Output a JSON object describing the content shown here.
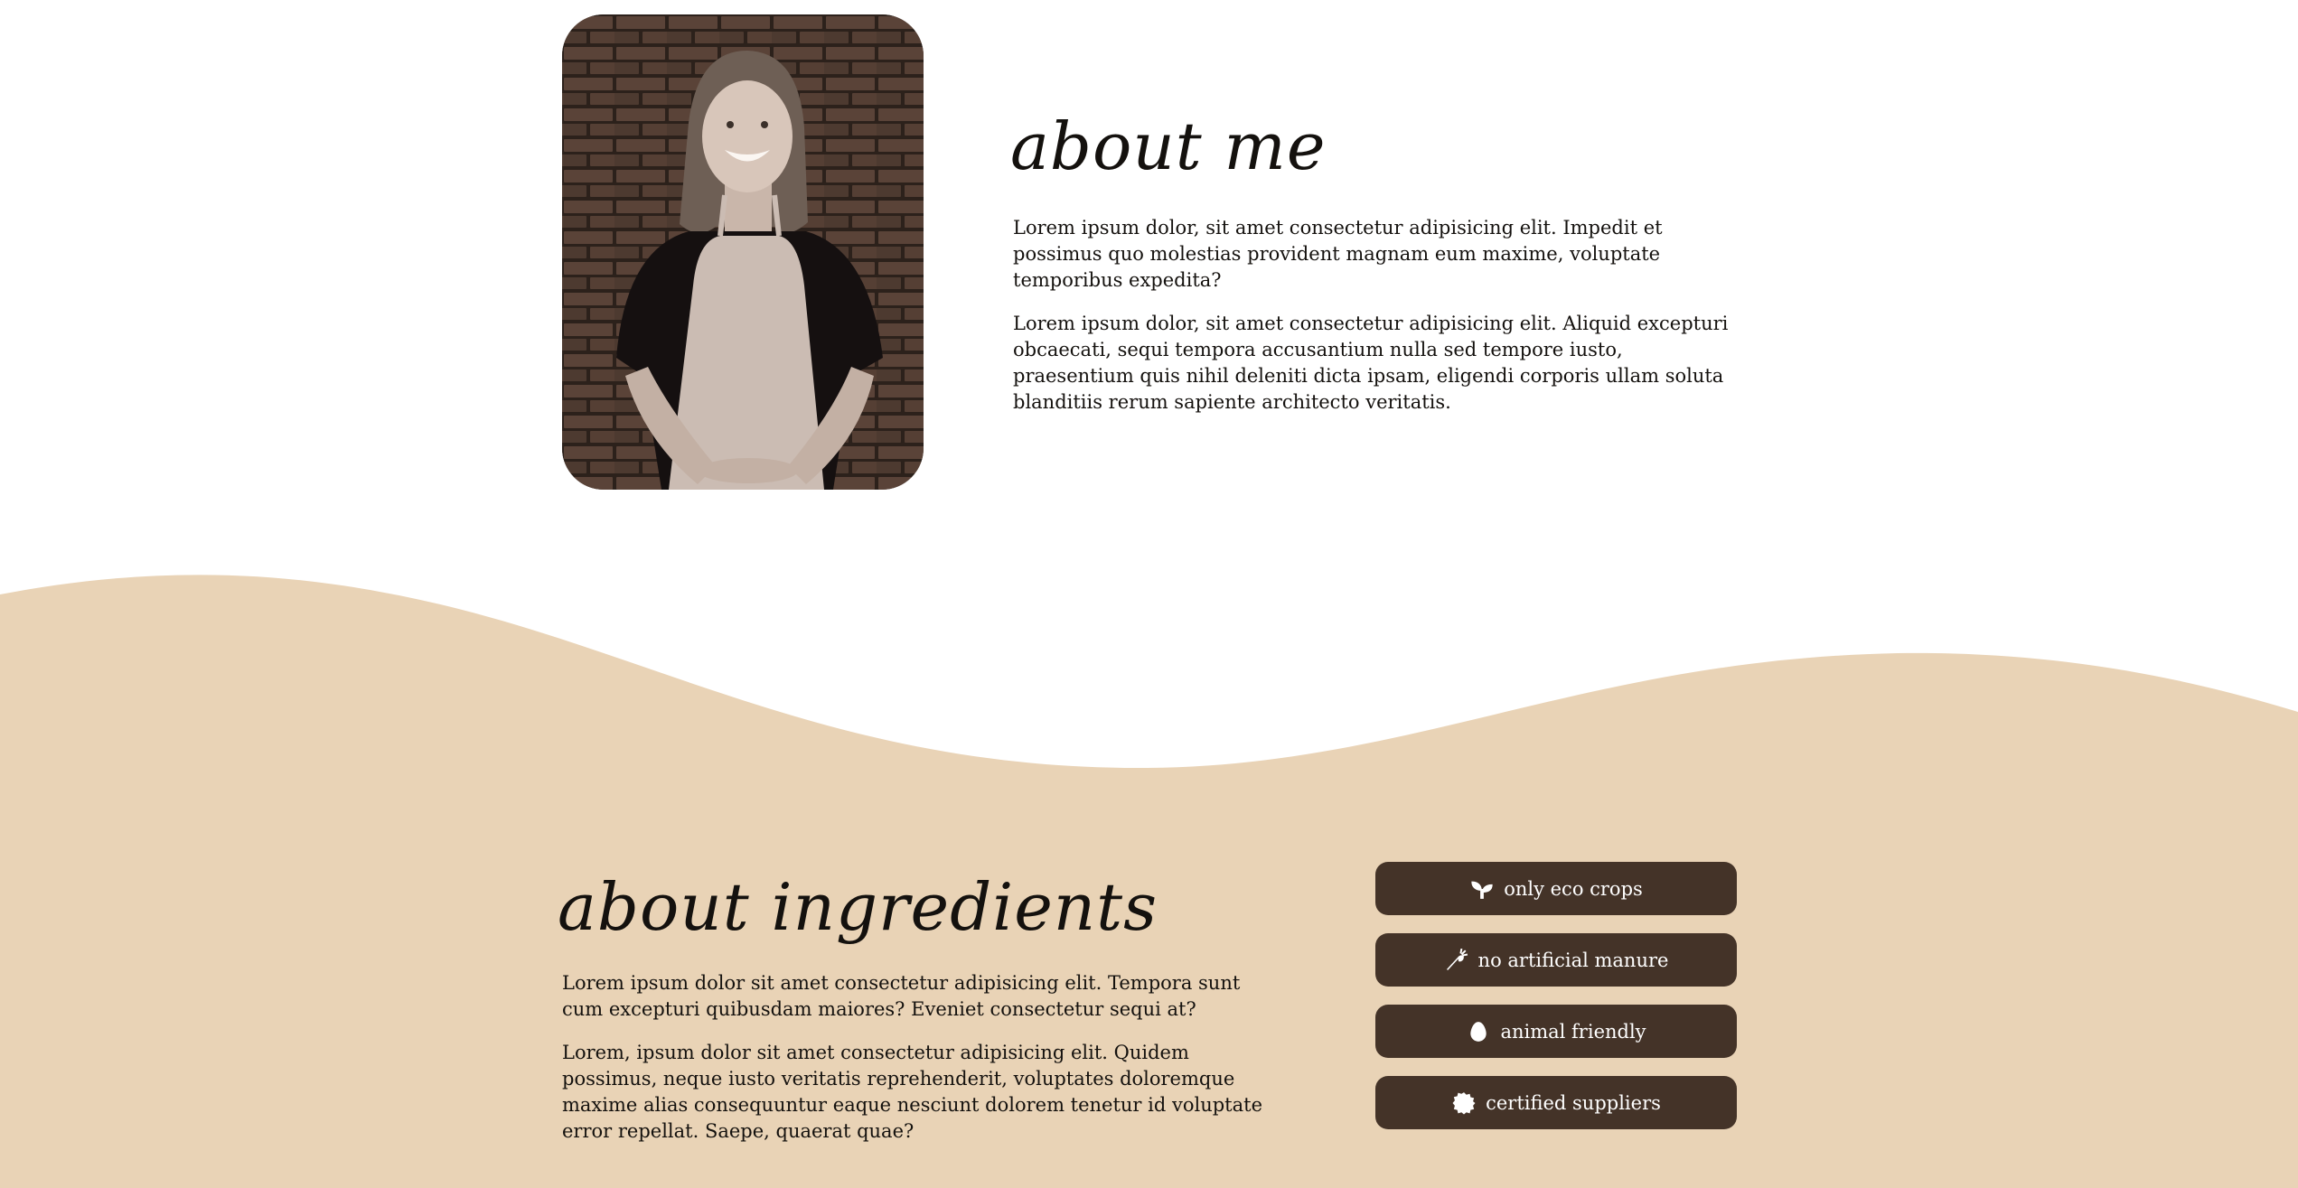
{
  "about_me": {
    "title": "about me",
    "paragraphs": [
      "Lorem ipsum dolor, sit amet consectetur adipisicing elit. Impedit et possimus quo molestias provident magnam eum maxime, voluptate temporibus expedita?",
      "Lorem ipsum dolor, sit amet consectetur adipisicing elit. Aliquid excepturi obcaecati, sequi tempora accusantium nulla sed tempore iusto, praesentium quis nihil deleniti dicta ipsam, eligendi corporis ullam soluta blanditiis rerum sapiente architecto veritatis."
    ]
  },
  "about_ingredients": {
    "title": "about ingredients",
    "paragraphs": [
      "Lorem ipsum dolor sit amet consectetur adipisicing elit. Tempora sunt cum excepturi quibusdam maiores? Eveniet consectetur sequi at?",
      "Lorem, ipsum dolor sit amet consectetur adipisicing elit. Quidem possimus, neque iusto veritatis reprehenderit, voluptates doloremque maxime alias consequuntur eaque nesciunt dolorem tenetur id voluptate error repellat. Saepe, quaerat quae?"
    ],
    "features": [
      {
        "label": "only eco crops",
        "icon": "seedling-icon"
      },
      {
        "label": "no artificial manure",
        "icon": "carrot-icon"
      },
      {
        "label": "animal friendly",
        "icon": "egg-icon"
      },
      {
        "label": "certified suppliers",
        "icon": "certificate-icon"
      }
    ]
  },
  "colors": {
    "wave": "#e9d3b6",
    "button": "#443328",
    "button_text": "#ffffff",
    "text": "#14110e"
  }
}
